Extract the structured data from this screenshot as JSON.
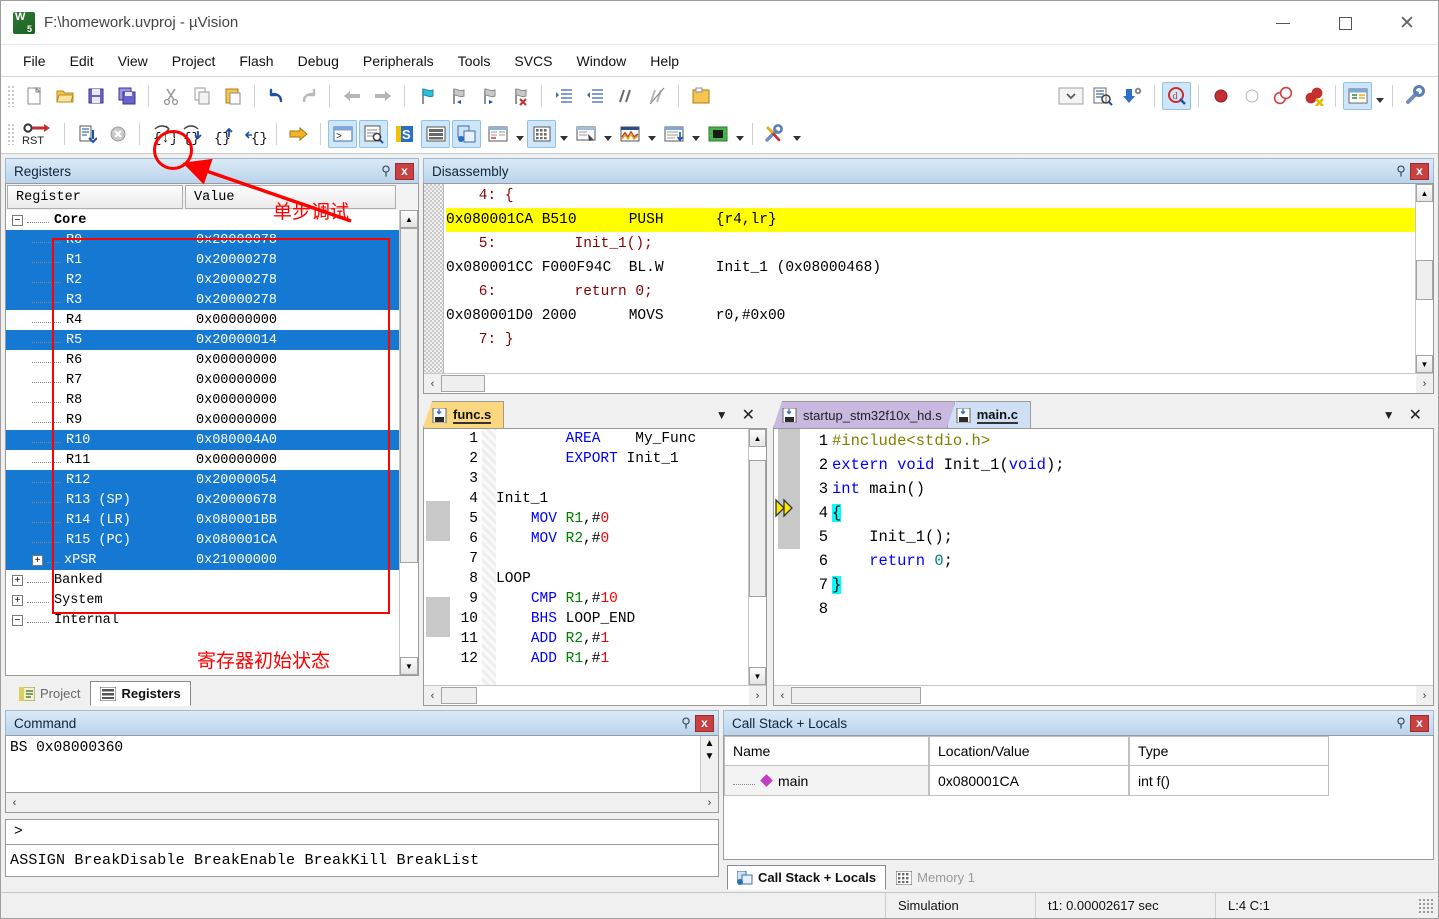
{
  "window": {
    "title": "F:\\homework.uvproj - µVision",
    "minimize": "—",
    "maximize": "□",
    "close": "✕"
  },
  "menu": [
    "File",
    "Edit",
    "View",
    "Project",
    "Flash",
    "Debug",
    "Peripherals",
    "Tools",
    "SVCS",
    "Window",
    "Help"
  ],
  "registers_panel": {
    "title": "Registers",
    "pin": "Φ",
    "close": "x",
    "columns": [
      "Register",
      "Value"
    ],
    "rows": [
      {
        "name": "Core",
        "value": "",
        "level": 0,
        "node": "minus",
        "selected": false,
        "bold": true
      },
      {
        "name": "R0",
        "value": "0x20000078",
        "level": 1,
        "node": "none",
        "selected": true
      },
      {
        "name": "R1",
        "value": "0x20000278",
        "level": 1,
        "node": "none",
        "selected": true
      },
      {
        "name": "R2",
        "value": "0x20000278",
        "level": 1,
        "node": "none",
        "selected": true
      },
      {
        "name": "R3",
        "value": "0x20000278",
        "level": 1,
        "node": "none",
        "selected": true
      },
      {
        "name": "R4",
        "value": "0x00000000",
        "level": 1,
        "node": "none",
        "selected": false
      },
      {
        "name": "R5",
        "value": "0x20000014",
        "level": 1,
        "node": "none",
        "selected": true
      },
      {
        "name": "R6",
        "value": "0x00000000",
        "level": 1,
        "node": "none",
        "selected": false
      },
      {
        "name": "R7",
        "value": "0x00000000",
        "level": 1,
        "node": "none",
        "selected": false
      },
      {
        "name": "R8",
        "value": "0x00000000",
        "level": 1,
        "node": "none",
        "selected": false
      },
      {
        "name": "R9",
        "value": "0x00000000",
        "level": 1,
        "node": "none",
        "selected": false
      },
      {
        "name": "R10",
        "value": "0x080004A0",
        "level": 1,
        "node": "none",
        "selected": true
      },
      {
        "name": "R11",
        "value": "0x00000000",
        "level": 1,
        "node": "none",
        "selected": false
      },
      {
        "name": "R12",
        "value": "0x20000054",
        "level": 1,
        "node": "none",
        "selected": true
      },
      {
        "name": "R13 (SP)",
        "value": "0x20000678",
        "level": 1,
        "node": "none",
        "selected": true
      },
      {
        "name": "R14 (LR)",
        "value": "0x080001BB",
        "level": 1,
        "node": "none",
        "selected": true
      },
      {
        "name": "R15 (PC)",
        "value": "0x080001CA",
        "level": 1,
        "node": "none",
        "selected": true
      },
      {
        "name": "xPSR",
        "value": "0x21000000",
        "level": 1,
        "node": "plus",
        "selected": true
      },
      {
        "name": "Banked",
        "value": "",
        "level": 0,
        "node": "plus",
        "selected": false
      },
      {
        "name": "System",
        "value": "",
        "level": 0,
        "node": "plus",
        "selected": false
      },
      {
        "name": "Internal",
        "value": "",
        "level": 0,
        "node": "minus",
        "selected": false
      }
    ],
    "tabs": [
      {
        "label": "Project",
        "active": false,
        "icon": "project-icon"
      },
      {
        "label": "Registers",
        "active": true,
        "icon": "registers-icon"
      }
    ]
  },
  "disassembly_panel": {
    "title": "Disassembly",
    "pin": "Φ",
    "close": "x",
    "lines": [
      {
        "kind": "source",
        "text": "    4: {"
      },
      {
        "kind": "code",
        "addr": "0x080001CA",
        "opcode": "B510",
        "mnemonic": "PUSH",
        "operands": "{r4,lr}",
        "highlight": true,
        "pc": true
      },
      {
        "kind": "source",
        "text": "    5:         Init_1();"
      },
      {
        "kind": "code",
        "addr": "0x080001CC",
        "opcode": "F000F94C",
        "mnemonic": "BL.W",
        "operands": "Init_1 (0x08000468)",
        "highlight": false,
        "pc": false
      },
      {
        "kind": "source",
        "text": "    6:         return 0;"
      },
      {
        "kind": "code",
        "addr": "0x080001D0",
        "opcode": "2000",
        "mnemonic": "MOVS",
        "operands": "r0,#0x00",
        "highlight": false,
        "pc": false
      },
      {
        "kind": "source",
        "text": "    7: }"
      }
    ]
  },
  "editor_left": {
    "tabs": [
      {
        "label": "func.s",
        "active": true,
        "color": "func"
      }
    ],
    "lines": [
      {
        "n": "1",
        "html": "        <span class='kw'>AREA</span>    My_Func"
      },
      {
        "n": "2",
        "html": "        <span class='kw'>EXPORT</span> Init_1"
      },
      {
        "n": "3",
        "html": ""
      },
      {
        "n": "4",
        "html": "Init_1"
      },
      {
        "n": "5",
        "html": "    <span class='kw'>MOV</span> <span class='reg2'>R1</span>,#<span class='num'>0</span>"
      },
      {
        "n": "6",
        "html": "    <span class='kw'>MOV</span> <span class='reg2'>R2</span>,#<span class='num'>0</span>"
      },
      {
        "n": "7",
        "html": ""
      },
      {
        "n": "8",
        "html": "LOOP"
      },
      {
        "n": "9",
        "html": "    <span class='kw'>CMP</span> <span class='reg2'>R1</span>,#<span class='num'>10</span>"
      },
      {
        "n": "10",
        "html": "    <span class='kw'>BHS</span> LOOP_END"
      },
      {
        "n": "11",
        "html": "    <span class='kw'>ADD</span> <span class='reg2'>R2</span>,#<span class='num'>1</span>"
      },
      {
        "n": "12",
        "html": "    <span class='kw'>ADD</span> <span class='reg2'>R1</span>,#<span class='num'>1</span>"
      }
    ]
  },
  "editor_right": {
    "tabs": [
      {
        "label": "startup_stm32f10x_hd.s",
        "active": false,
        "color": "startup"
      },
      {
        "label": "main.c",
        "active": true,
        "color": "mainc"
      }
    ],
    "lines": [
      {
        "n": "1",
        "html": "<span class='str'>#include&lt;stdio.h&gt;</span>"
      },
      {
        "n": "2",
        "html": "<span class='kw'>extern void</span> Init_1(<span class='kw'>void</span>);"
      },
      {
        "n": "3",
        "html": "<span class='kw'>int</span> main()"
      },
      {
        "n": "4",
        "html": "<span class='cy'>{</span>",
        "marker": true
      },
      {
        "n": "5",
        "html": "    Init_1();"
      },
      {
        "n": "6",
        "html": "    <span class='kw'>return</span> <span class='teal'>0</span>;"
      },
      {
        "n": "7",
        "html": "<span class='cy'>}</span>"
      },
      {
        "n": "8",
        "html": ""
      }
    ]
  },
  "command_panel": {
    "title": "Command",
    "pin": "Φ",
    "close": "x",
    "output": "BS  0x08000360",
    "prompt": ">",
    "input_value": "",
    "hint": "ASSIGN BreakDisable BreakEnable BreakKill BreakList"
  },
  "callstack_panel": {
    "title": "Call Stack + Locals",
    "pin": "Φ",
    "close": "x",
    "columns": [
      "Name",
      "Location/Value",
      "Type"
    ],
    "rows": [
      {
        "name": "main",
        "location": "0x080001CA",
        "type": "int f()"
      }
    ],
    "tabs": [
      {
        "label": "Call Stack + Locals",
        "active": true,
        "icon": "callstack-icon"
      },
      {
        "label": "Memory 1",
        "active": false,
        "icon": "memory-icon"
      }
    ]
  },
  "status_bar": {
    "mode": "Simulation",
    "time": "t1: 0.00002617 sec",
    "cursor": "L:4 C:1"
  },
  "annotations": [
    {
      "id": "step-debug-note",
      "text": "单步调试",
      "color": "#ff0000"
    },
    {
      "id": "register-initial-state-note",
      "text": "寄存器初始状态",
      "color": "#ff0000"
    }
  ],
  "toolbar_main": [
    {
      "name": "new-file-icon"
    },
    {
      "name": "open-file-icon"
    },
    {
      "name": "save-icon"
    },
    {
      "name": "save-all-icon"
    },
    {
      "sep": true
    },
    {
      "name": "cut-icon"
    },
    {
      "name": "copy-icon"
    },
    {
      "name": "paste-icon"
    },
    {
      "sep": true
    },
    {
      "name": "undo-icon"
    },
    {
      "name": "redo-icon"
    },
    {
      "sep": true
    },
    {
      "name": "navigate-back-icon"
    },
    {
      "name": "navigate-forward-icon"
    },
    {
      "sep": true
    },
    {
      "name": "bookmark-toggle-icon"
    },
    {
      "name": "bookmark-prev-icon"
    },
    {
      "name": "bookmark-next-icon"
    },
    {
      "name": "bookmark-clear-icon"
    },
    {
      "sep": true
    },
    {
      "name": "indent-icon"
    },
    {
      "name": "outdent-icon"
    },
    {
      "name": "comment-icon"
    },
    {
      "name": "uncomment-icon"
    },
    {
      "sep": true
    },
    {
      "name": "build-icon"
    }
  ],
  "toolbar_debug": [
    {
      "name": "reset-icon",
      "label": "RST"
    },
    {
      "sep": true
    },
    {
      "name": "run-icon"
    },
    {
      "name": "stop-icon"
    },
    {
      "sep": true
    },
    {
      "name": "step-into-icon",
      "circled": true
    },
    {
      "name": "step-over-icon"
    },
    {
      "name": "step-out-icon"
    },
    {
      "name": "run-to-cursor-icon"
    },
    {
      "sep": true
    },
    {
      "name": "show-next-statement-icon"
    },
    {
      "sep": true
    },
    {
      "name": "command-window-icon",
      "active": true
    },
    {
      "name": "disassembly-window-icon",
      "active": true
    },
    {
      "name": "symbols-window-icon"
    },
    {
      "name": "registers-window-icon",
      "active": true
    },
    {
      "name": "callstack-window-icon",
      "active": true
    },
    {
      "name": "watch-window-icon",
      "dropdown": true
    },
    {
      "name": "memory-window-icon",
      "active": true,
      "dropdown": true
    },
    {
      "name": "serial-window-icon",
      "dropdown": true
    },
    {
      "name": "analysis-window-icon",
      "dropdown": true
    },
    {
      "name": "trace-window-icon",
      "dropdown": true
    },
    {
      "name": "system-viewer-icon",
      "dropdown": true
    },
    {
      "sep": true
    },
    {
      "name": "tools-icon",
      "dropdown": true
    }
  ],
  "toolbar_right": [
    {
      "name": "target-select-icon"
    },
    {
      "name": "target-options-icon"
    },
    {
      "name": "manage-components-icon"
    },
    {
      "sep": true
    },
    {
      "name": "start-debug-icon",
      "active": true
    },
    {
      "sep": true
    },
    {
      "name": "insert-breakpoint-icon"
    },
    {
      "name": "disable-breakpoint-icon"
    },
    {
      "name": "disable-all-breakpoints-icon"
    },
    {
      "name": "kill-all-breakpoints-icon"
    },
    {
      "sep": true
    },
    {
      "name": "project-window-icon",
      "active": true,
      "dropdown": true
    },
    {
      "sep": true
    },
    {
      "name": "configure-icon"
    }
  ]
}
